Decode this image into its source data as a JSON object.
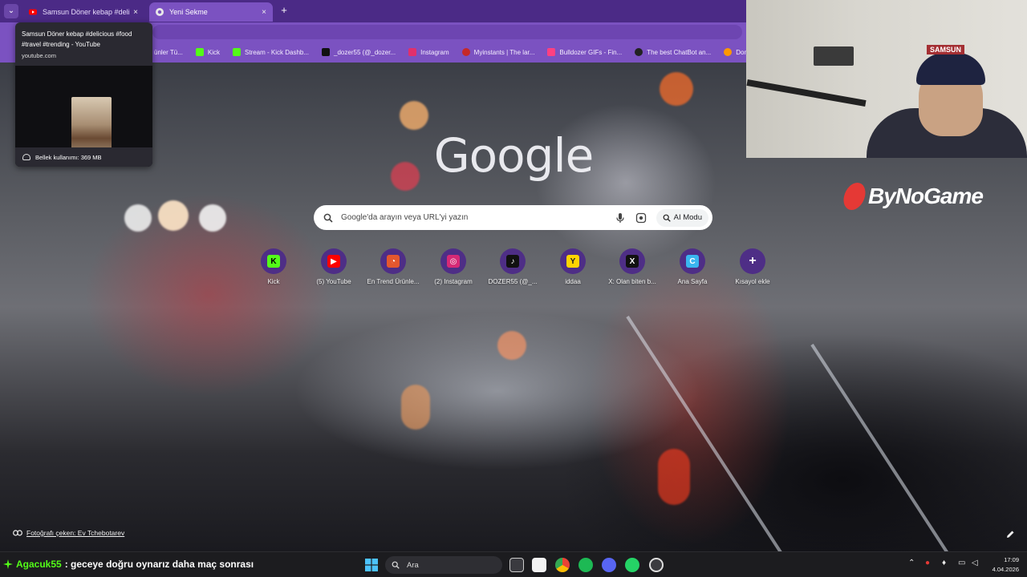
{
  "browser": {
    "tabs": [
      {
        "title": "Samsun Döner kebap #delicious",
        "close": "×"
      },
      {
        "title": "Yeni Sekme",
        "close": "×"
      }
    ],
    "new_tab": "+",
    "tab_dropdown": "⌄",
    "hover_card": {
      "title": "Samsun Döner kebap #delicious #food #travel #trending - YouTube",
      "url": "youtube.com",
      "memory": "Bellek kullanımı: 369 MB"
    },
    "bookmarks": [
      {
        "label": "ünler Tü...",
        "color": "#c7c7c7"
      },
      {
        "label": "Kick",
        "color": "#53fc18"
      },
      {
        "label": "Stream - Kick Dashb...",
        "color": "#53fc18"
      },
      {
        "label": "_dozer55 (@_dozer...",
        "color": "#111111"
      },
      {
        "label": "Instagram",
        "color": "#e1306c"
      },
      {
        "label": "Myinstants | The lar...",
        "color": "#c62828"
      },
      {
        "label": "Bulldozer GIFs - Fin...",
        "color": "#ff4081"
      },
      {
        "label": "The best ChatBot an...",
        "color": "#222222"
      },
      {
        "label": "Donate ByNoGame",
        "color": "#ff9800"
      }
    ]
  },
  "newtab": {
    "logo": "Google",
    "search": {
      "placeholder": "Google'da arayın veya URL'yi yazın",
      "ai_mode": "AI Modu"
    },
    "shortcuts": [
      {
        "label": "Kick",
        "icon": "K",
        "bg": "#53fc18",
        "fg": "#000000"
      },
      {
        "label": "(5) YouTube",
        "icon": "▶",
        "bg": "#ff0000",
        "fg": "#ffffff"
      },
      {
        "label": "En Trend Ürünle...",
        "icon": "◔",
        "bg": "#e4572e",
        "fg": "#ffffff"
      },
      {
        "label": "(2) Instagram",
        "icon": "◎",
        "bg": "#d62976",
        "fg": "#ffffff"
      },
      {
        "label": "DOZER55 (@_...",
        "icon": "♪",
        "bg": "#111111",
        "fg": "#ffffff"
      },
      {
        "label": "iddaa",
        "icon": "Y",
        "bg": "#ffd400",
        "fg": "#222222"
      },
      {
        "label": "X: Olan biten b...",
        "icon": "X",
        "bg": "#111111",
        "fg": "#ffffff"
      },
      {
        "label": "Ana Sayfa",
        "icon": "C",
        "bg": "#3ab6f0",
        "fg": "#ffffff"
      },
      {
        "label": "Kısayol ekle",
        "icon": "+",
        "bg": "transparent",
        "fg": "#ffffff"
      }
    ],
    "photo_credit": "Fotoğrafı çeken: Ev Tchebotarev"
  },
  "overlay": {
    "samsun_sign": "SAMSUN",
    "brand": "ByNoGame"
  },
  "taskbar": {
    "chat_user": "Agacuk55",
    "chat_message": ": geceye doğru oynarız daha maç sonrası",
    "search_label": "Ara",
    "time": "17:09",
    "date": "4.04.2026"
  }
}
